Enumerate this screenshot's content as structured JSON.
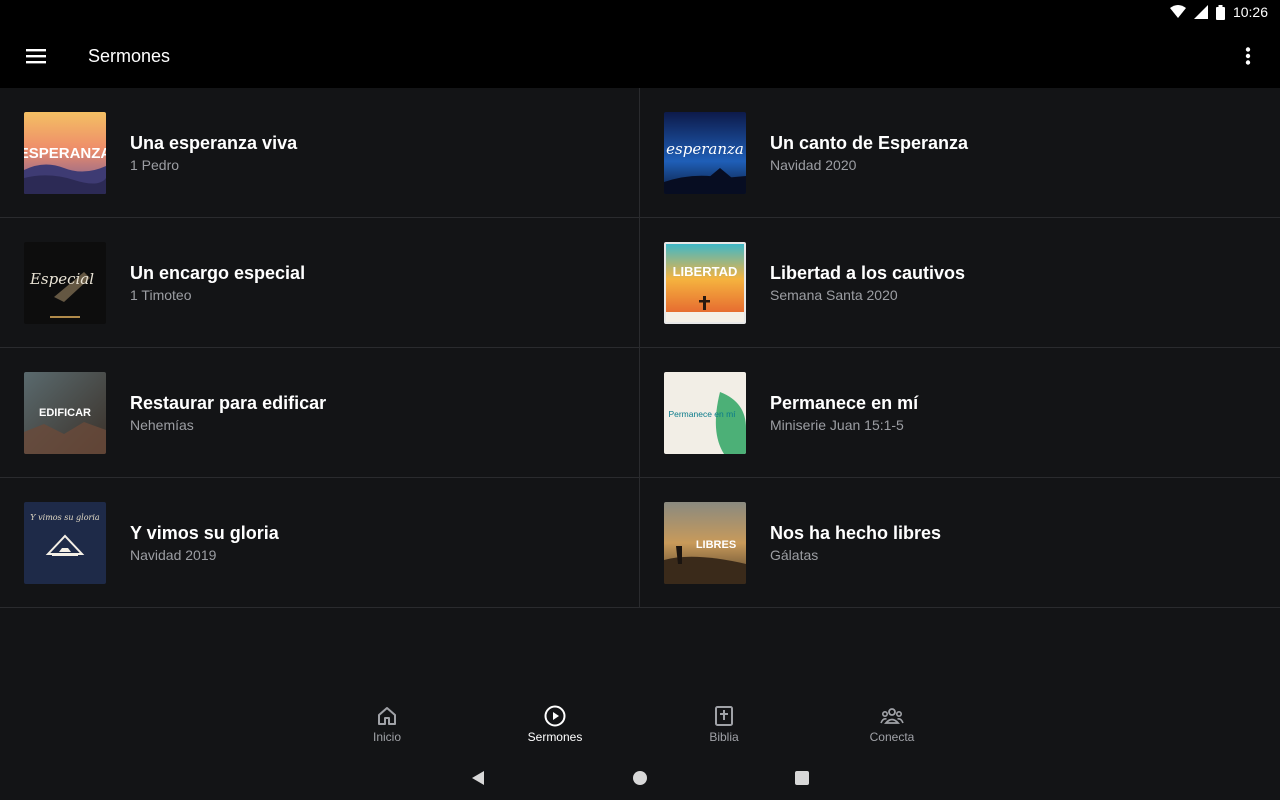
{
  "status_bar": {
    "time": "10:26"
  },
  "app_bar": {
    "title": "Sermones"
  },
  "sermons": [
    {
      "title": "Una esperanza viva",
      "subtitle": "1 Pedro",
      "thumb_text": "ESPERANZA"
    },
    {
      "title": "Un canto de Esperanza",
      "subtitle": "Navidad 2020",
      "thumb_text": "esperanza"
    },
    {
      "title": "Un encargo especial",
      "subtitle": "1 Timoteo",
      "thumb_text": "Especial"
    },
    {
      "title": "Libertad a los cautivos",
      "subtitle": "Semana Santa 2020",
      "thumb_text": "LIBERTAD"
    },
    {
      "title": "Restaurar para edificar",
      "subtitle": "Nehemías",
      "thumb_text": "EDIFICAR"
    },
    {
      "title": "Permanece en mí",
      "subtitle": "Miniserie Juan 15:1-5",
      "thumb_text": "Permanece en mí"
    },
    {
      "title": "Y vimos su gloria",
      "subtitle": "Navidad 2019",
      "thumb_text": "Y vimos su gloria"
    },
    {
      "title": "Nos ha hecho libres",
      "subtitle": "Gálatas",
      "thumb_text": "LIBRES"
    }
  ],
  "bottom_nav": [
    {
      "label": "Inicio",
      "icon": "home-icon"
    },
    {
      "label": "Sermones",
      "icon": "play-circle-icon",
      "active": true
    },
    {
      "label": "Biblia",
      "icon": "bible-icon"
    },
    {
      "label": "Conecta",
      "icon": "people-icon"
    }
  ],
  "colors": {
    "background": "#131416",
    "bar": "#000000",
    "divider": "#2a2b2e",
    "subtitle": "#9c9ea3"
  }
}
